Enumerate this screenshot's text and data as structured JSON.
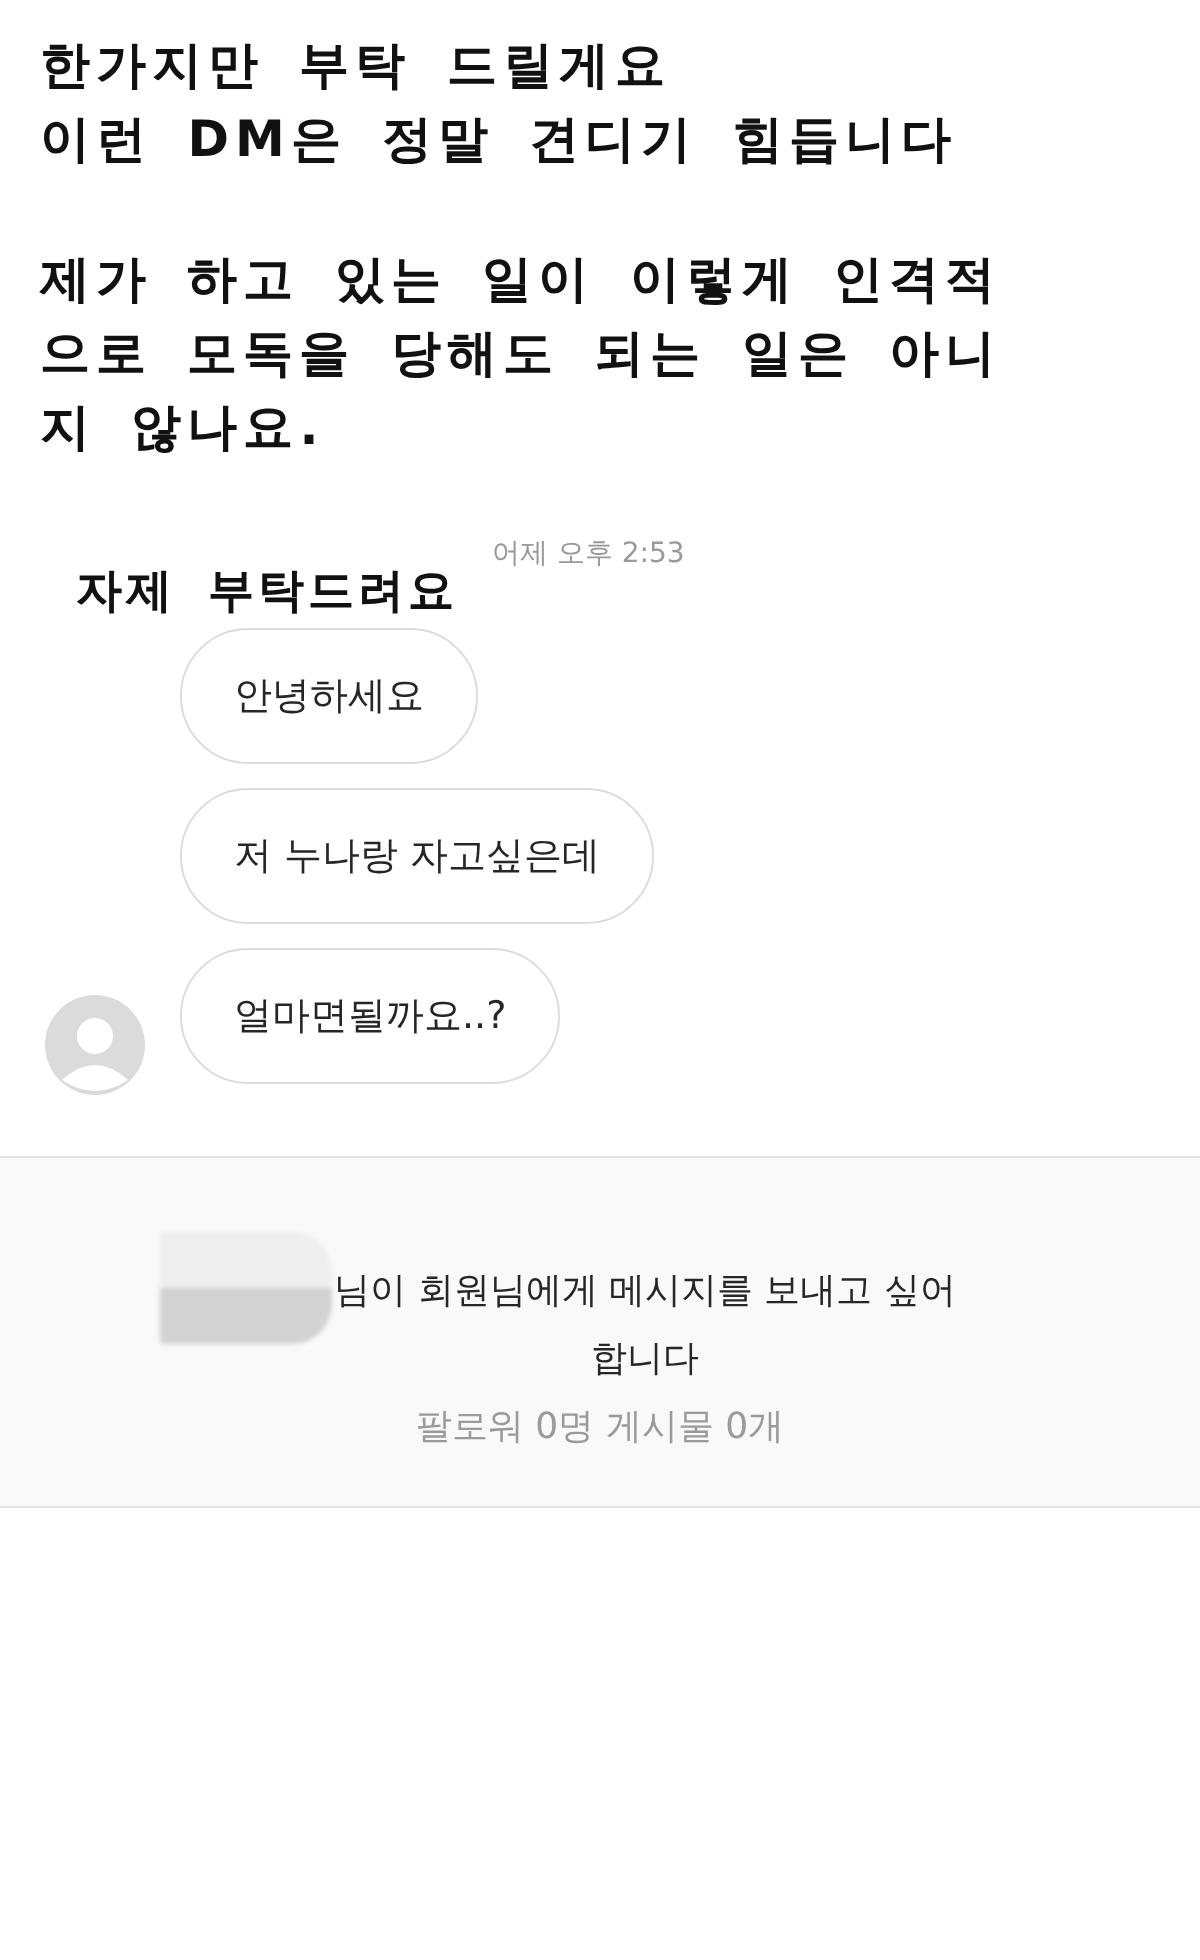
{
  "annotation": {
    "paragraphs": [
      [
        "한가지만 부탁 드릴게요",
        "이런 DM은 정말 견디기 힘듭니다"
      ],
      [
        "제가 하고 있는 일이 이렇게 인격적",
        "으로 모독을 당해도 되는 일은 아니",
        "지 않나요."
      ]
    ]
  },
  "thread": {
    "timestamp": "어제 오후 2:53",
    "caption": "자제 부탁드려요",
    "messages": [
      {
        "text": "안녕하세요"
      },
      {
        "text": "저 누나랑 자고싶은데"
      },
      {
        "text": "얼마면될까요..?"
      }
    ]
  },
  "request": {
    "message": "님이 회원님에게 메시지를 보내고 싶어 합니다",
    "stats": "팔로워 0명 게시물 0개"
  }
}
